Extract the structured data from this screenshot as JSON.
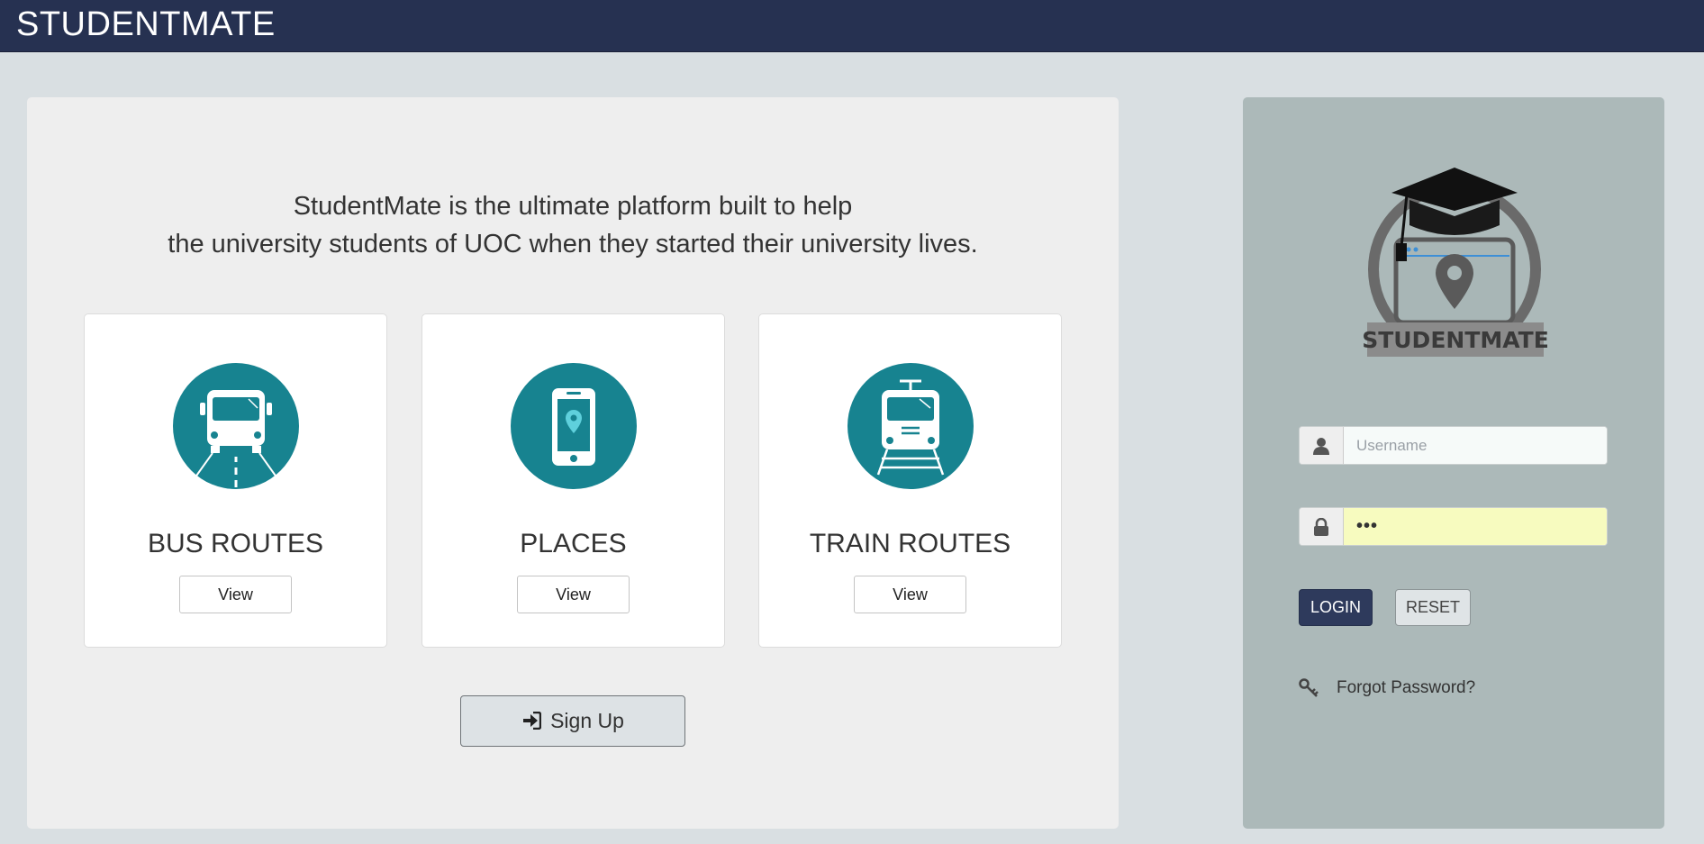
{
  "navbar": {
    "brand": "STUDENTMATE"
  },
  "intro": {
    "line1": "StudentMate is the ultimate platform built to help",
    "line2": "the university students of UOC when they started their university lives."
  },
  "cards": [
    {
      "title": "BUS ROUTES",
      "button": "View",
      "icon": "bus-icon"
    },
    {
      "title": "PLACES",
      "button": "View",
      "icon": "phone-location-icon"
    },
    {
      "title": "TRAIN ROUTES",
      "button": "View",
      "icon": "train-icon"
    }
  ],
  "signup": {
    "label": "Sign Up",
    "icon": "sign-in-icon"
  },
  "login": {
    "logo_text": "STUDENTMATE",
    "username_placeholder": "Username",
    "password_value": "•••",
    "login_label": "LOGIN",
    "reset_label": "RESET",
    "forgot_label": "Forgot Password?"
  },
  "colors": {
    "navbar": "#263151",
    "accent_teal": "#178390",
    "login_button": "#2e3a5c",
    "login_panel": "#acb9b9",
    "page_bg": "#d9dfe2"
  }
}
